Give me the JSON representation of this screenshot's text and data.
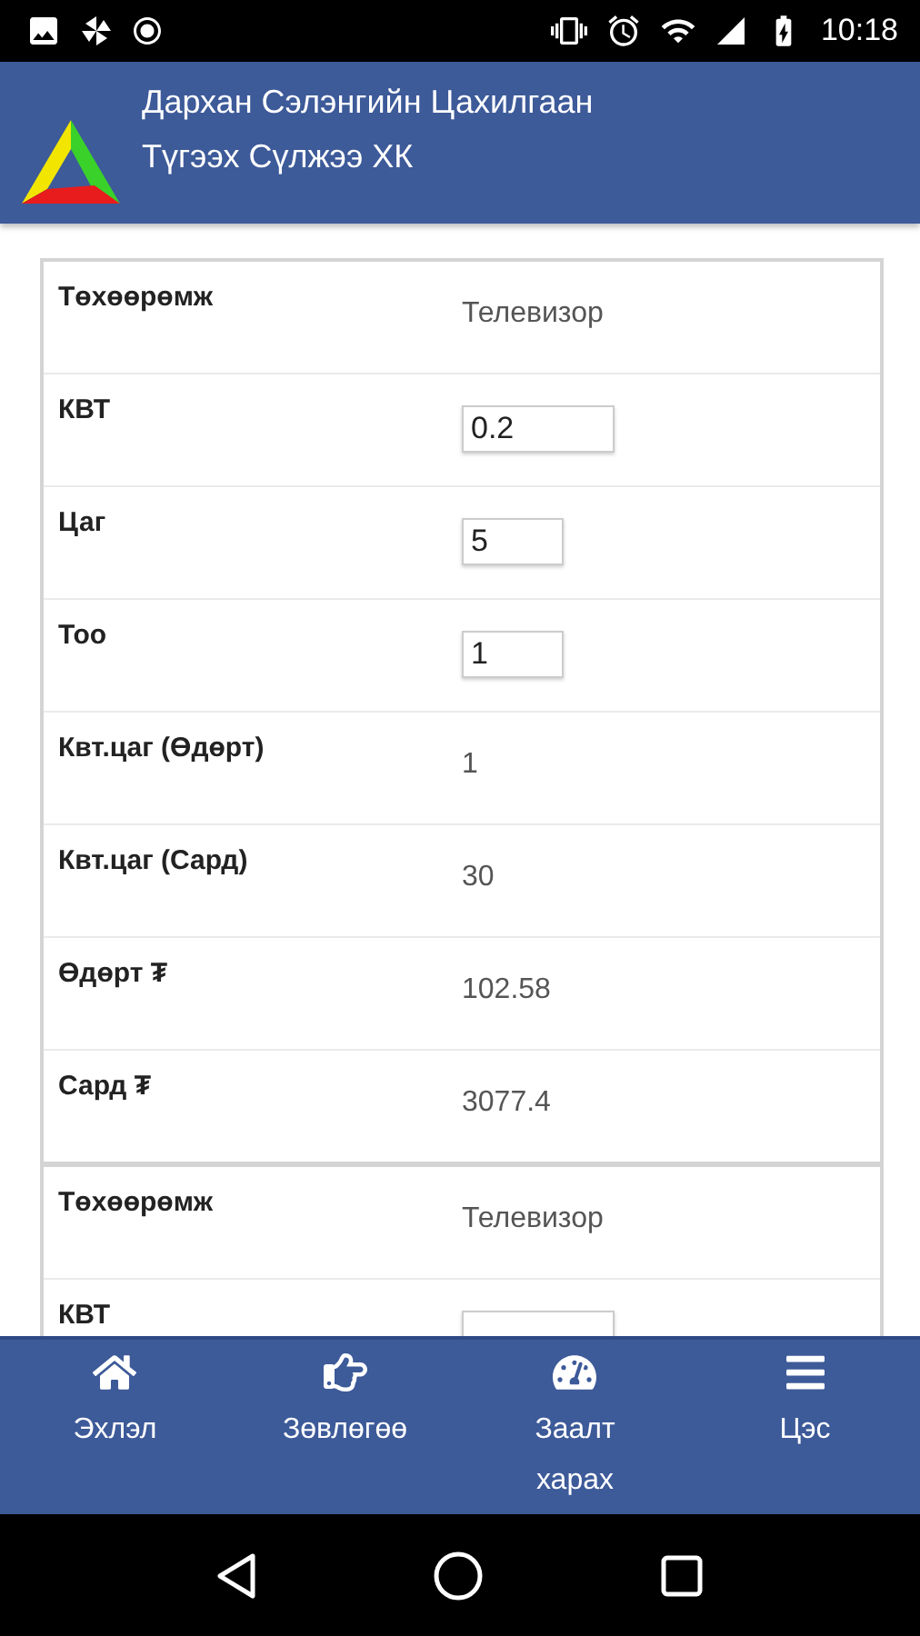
{
  "status_bar": {
    "time": "10:18"
  },
  "header": {
    "title_lines": [
      "Дархан Сэлэнгийн Цахилгаан",
      "Түгээх Сүлжээ ХК"
    ]
  },
  "cards": [
    {
      "rows": [
        {
          "label": "Төхөөрөмж",
          "kind": "text",
          "value": "Телевизор"
        },
        {
          "label": "КВТ",
          "kind": "field",
          "value": "0.2"
        },
        {
          "label": "Цаг",
          "kind": "field",
          "value": "5"
        },
        {
          "label": "Тоо",
          "kind": "field",
          "value": "1"
        },
        {
          "label": "Квт.цаг (Өдөрт)",
          "kind": "text",
          "value": "1"
        },
        {
          "label": "Квт.цаг (Сард)",
          "kind": "text",
          "value": "30"
        },
        {
          "label": "Өдөрт ₮",
          "kind": "text",
          "value": "102.58"
        },
        {
          "label": "Сард ₮",
          "kind": "text",
          "value": "3077.4"
        }
      ]
    },
    {
      "rows": [
        {
          "label": "Төхөөрөмж",
          "kind": "text",
          "value": "Телевизор"
        },
        {
          "label": "КВТ",
          "kind": "field"
        }
      ]
    }
  ],
  "bottom_nav": [
    {
      "label": "Эхлэл",
      "kind": "home"
    },
    {
      "label": "Зөвлөгөө",
      "kind": "advice"
    },
    {
      "label": "Заалт харах",
      "kind": "meter"
    },
    {
      "label": "Цэс",
      "kind": "menu"
    }
  ]
}
